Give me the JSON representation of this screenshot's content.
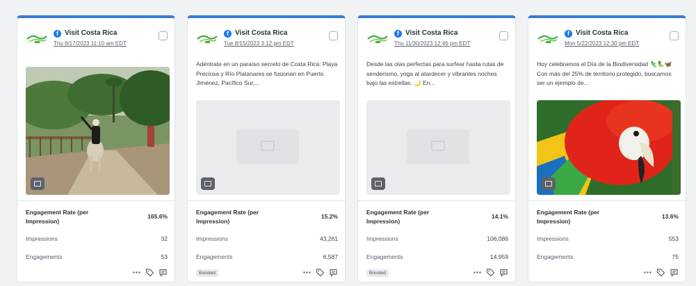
{
  "icons": {
    "facebook": "facebook-icon",
    "logo": "visit-costa-rica-logo",
    "media_badge": "image-icon",
    "more": "more-icon",
    "tag": "tag-icon",
    "comment": "comment-icon",
    "placeholder": "image-placeholder-icon"
  },
  "colors": {
    "accent": "#3a7bd5",
    "facebook": "#1877f2",
    "logo_green": "#3fae49"
  },
  "cards": [
    {
      "account": "Visit Costa Rica",
      "timestamp": "Thu 8/17/2023 11:10 am EDT",
      "text": "",
      "media": "photo-horse-rider",
      "metrics": {
        "er_label": "Engagement Rate (per Impression)",
        "er_value": "165.6%",
        "impressions_label": "Impressions",
        "impressions_value": "32",
        "engagements_label": "Engagements",
        "engagements_value": "53"
      },
      "boosted": ""
    },
    {
      "account": "Visit Costa Rica",
      "timestamp": "Tue 8/15/2023 3:12 pm EDT",
      "text": "Adéntrate en un paraíso secreto de Costa Rica: Playa Preciosa y Río Platanares se fusionan en Puerto Jiménez, Pacífico Sur,...",
      "media": "placeholder",
      "metrics": {
        "er_label": "Engagement Rate (per Impression)",
        "er_value": "15.2%",
        "impressions_label": "Impressions",
        "impressions_value": "43,261",
        "engagements_label": "Engagements",
        "engagements_value": "6,587"
      },
      "boosted": "Boosted"
    },
    {
      "account": "Visit Costa Rica",
      "timestamp": "Thu 11/30/2023 12:46 pm EDT",
      "text": "Desde las olas perfectas para surfear hasta rutas de senderismo, yoga al atardecer y vibrantes noches bajo las estrellas. 🌙 En...",
      "media": "placeholder",
      "metrics": {
        "er_label": "Engagement Rate (per Impression)",
        "er_value": "14.1%",
        "impressions_label": "Impressions",
        "impressions_value": "106,086",
        "engagements_label": "Engagements",
        "engagements_value": "14,959"
      },
      "boosted": "Boosted"
    },
    {
      "account": "Visit Costa Rica",
      "timestamp": "Mon 5/22/2023 12:30 pm EDT",
      "text": "Hoy celebramos el Día de la Biodiversidad 🦎🦜🦋 Con más del 25% de territorio protegido, buscamos ser un ejemplo de...",
      "media": "photo-macaw",
      "metrics": {
        "er_label": "Engagement Rate (per Impression)",
        "er_value": "13.6%",
        "impressions_label": "Impressions",
        "impressions_value": "553",
        "engagements_label": "Engagements",
        "engagements_value": "75"
      },
      "boosted": ""
    }
  ]
}
